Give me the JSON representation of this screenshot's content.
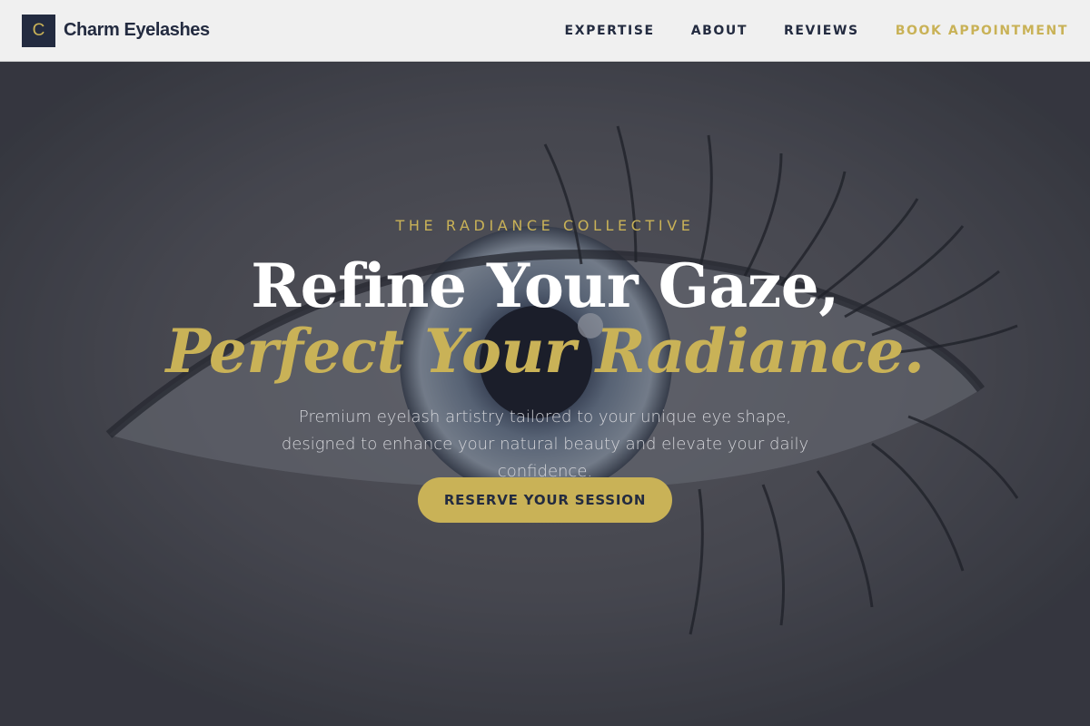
{
  "brand": {
    "logo_letter": "C",
    "name": "Charm Eyelashes"
  },
  "nav": {
    "items": [
      {
        "label": "EXPERTISE"
      },
      {
        "label": "ABOUT"
      },
      {
        "label": "REVIEWS"
      }
    ],
    "cta_label": "BOOK APPOINTMENT"
  },
  "hero": {
    "eyebrow": "THE RADIANCE COLLECTIVE",
    "headline_line1": "Refine Your Gaze,",
    "headline_line2": "Perfect Your Radiance.",
    "subtitle": "Premium eyelash artistry tailored to your unique eye shape, designed to enhance your natural beauty and elevate your daily confidence.",
    "button_label": "RESERVE YOUR SESSION",
    "background_image": "close-up-eye-photo"
  },
  "colors": {
    "navy": "#232b40",
    "gold": "#c9b257",
    "header_bg": "#f0f0f0",
    "white": "#ffffff"
  }
}
